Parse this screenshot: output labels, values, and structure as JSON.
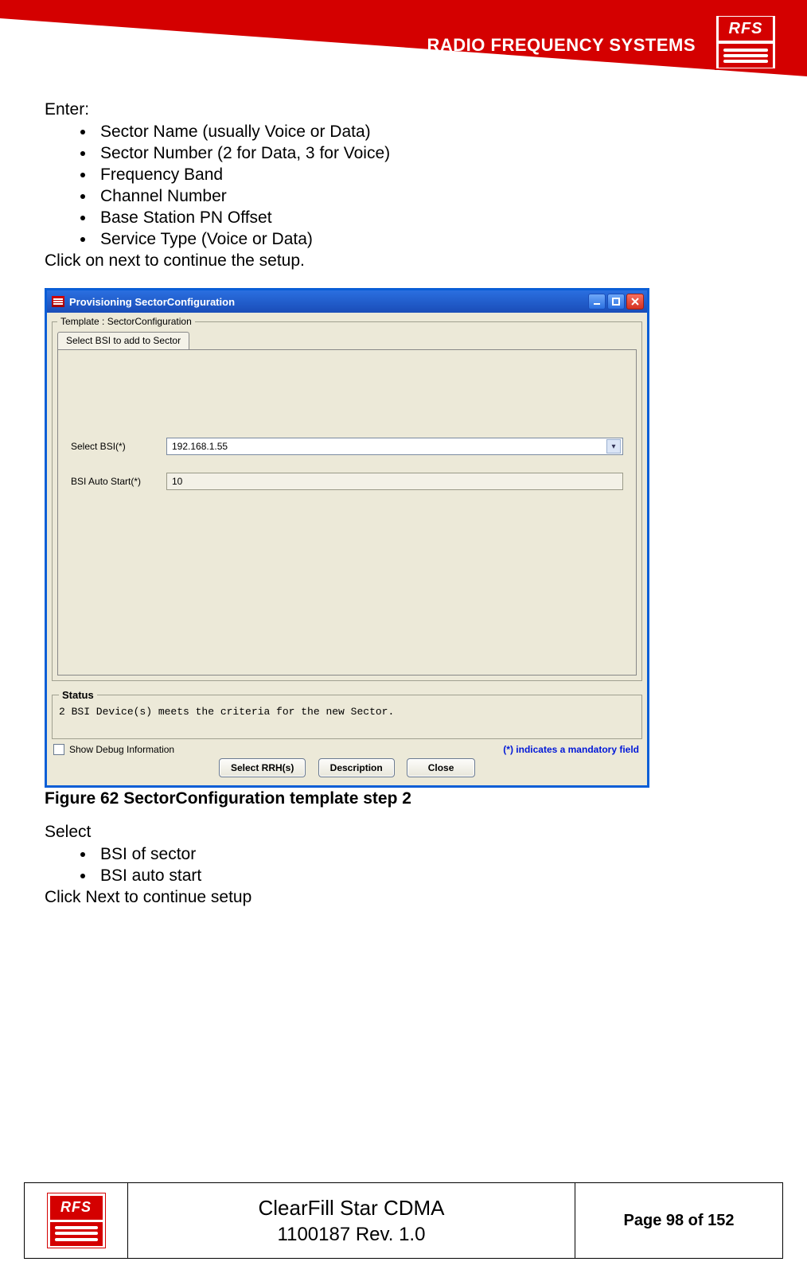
{
  "header": {
    "brand_text": "RADIO FREQUENCY SYSTEMS",
    "logo_text": "RFS"
  },
  "intro": {
    "enter_label": "Enter:",
    "bullets": [
      "Sector Name (usually Voice or Data)",
      "Sector Number (2 for Data, 3 for Voice)",
      "Frequency Band",
      "Channel Number",
      "Base Station PN Offset",
      "Service Type (Voice or Data)"
    ],
    "after": "Click on next to continue the setup."
  },
  "window": {
    "title": "Provisioning SectorConfiguration",
    "template_legend": "Template : SectorConfiguration",
    "tab_label": "Select BSI to add to Sector",
    "fields": {
      "select_bsi_label": "Select BSI(*)",
      "select_bsi_value": "192.168.1.55",
      "auto_start_label": "BSI Auto Start(*)",
      "auto_start_value": "10"
    },
    "status_legend": "Status",
    "status_message": "2 BSI Device(s) meets the criteria for the new Sector.",
    "show_debug_label": "Show Debug Information",
    "mandatory_note": "(*) indicates a mandatory field",
    "buttons": {
      "select_rrh": "Select RRH(s)",
      "description": "Description",
      "close": "Close"
    }
  },
  "figure_caption": "Figure 62 SectorConfiguration template step 2",
  "select_section": {
    "heading": "Select",
    "bullets": [
      "BSI of sector",
      "BSI auto start"
    ],
    "after": "Click Next to continue setup"
  },
  "footer": {
    "logo_text": "RFS",
    "doc_title": "ClearFill Star CDMA",
    "doc_rev": "1100187 Rev. 1.0",
    "page": "Page 98 of 152"
  }
}
